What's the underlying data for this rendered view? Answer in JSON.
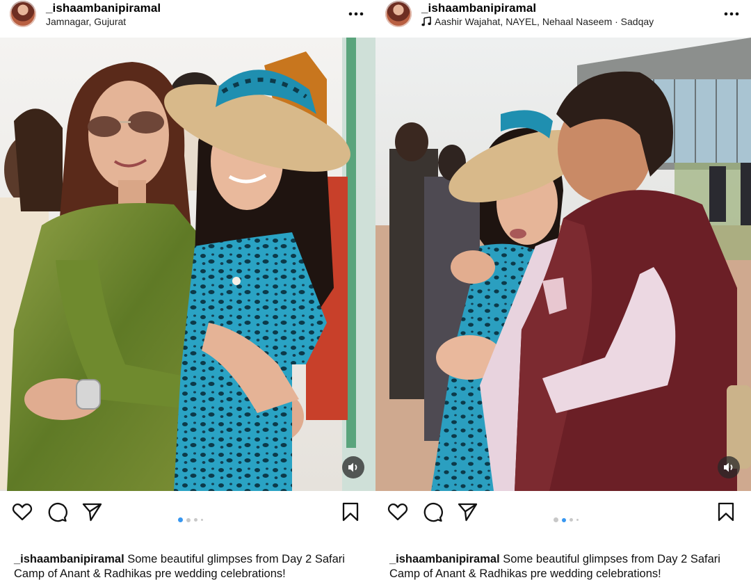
{
  "posts": [
    {
      "username": "_ishaambanipiramal",
      "location": "Jamnagar, Gujurat",
      "music": "",
      "caption_text": "Some beautiful glimpses from Day 2 Safari Camp of Anant & Radhikas pre wedding celebrations!",
      "carousel_active_index": 0,
      "carousel_count": 4
    },
    {
      "username": "_ishaambanipiramal",
      "location": "",
      "music": "Aashir Wajahat, NAYEL, Nehaal Naseem · Sadqay",
      "caption_text": "Some beautiful glimpses from Day 2 Safari Camp of Anant & Radhikas pre wedding celebrations!",
      "carousel_active_index": 1,
      "carousel_count": 4
    }
  ],
  "icons": {
    "like": "heart-icon",
    "comment": "comment-icon",
    "share": "send-icon",
    "save": "bookmark-icon",
    "more": "more-options-icon",
    "audio": "speaker-icon",
    "music": "music-note-icon"
  },
  "colors": {
    "carousel_active": "#3897f0",
    "carousel_inactive": "#c8c8c8",
    "text": "#111111"
  }
}
